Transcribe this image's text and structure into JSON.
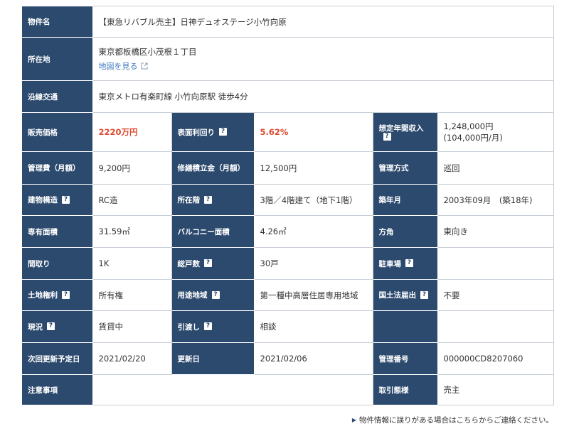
{
  "rows": {
    "name": {
      "label": "物件名",
      "value": "【東急リバブル売主】日神デュオステージ小竹向原"
    },
    "address": {
      "label": "所在地",
      "value": "東京都板橋区小茂根１丁目",
      "map_link": "地図を見る"
    },
    "line": {
      "label": "沿線交通",
      "value": "東京メトロ有楽町線 小竹向原駅 徒歩4分"
    },
    "price": {
      "label": "販売価格",
      "value": "2220万円"
    },
    "yield": {
      "label": "表面利回り",
      "value": "5.62%"
    },
    "income": {
      "label": "想定年間収入",
      "value1": "1,248,000円",
      "value2": "(104,000円/月)"
    },
    "mgmt_fee": {
      "label": "管理費（月額）",
      "value": "9,200円"
    },
    "repair_fund": {
      "label": "修繕積立金（月額）",
      "value": "12,500円"
    },
    "mgmt_method": {
      "label": "管理方式",
      "value": "巡回"
    },
    "structure": {
      "label": "建物構造",
      "value": "RC造"
    },
    "floor": {
      "label": "所在階",
      "value": "3階／4階建て（地下1階）"
    },
    "built": {
      "label": "築年月",
      "value": "2003年09月　(築18年)"
    },
    "area": {
      "label": "専有面積",
      "value": "31.59㎡"
    },
    "balcony": {
      "label": "バルコニー面積",
      "value": "4.26㎡"
    },
    "direction": {
      "label": "方角",
      "value": "東向き"
    },
    "layout": {
      "label": "間取り",
      "value": "1K"
    },
    "units": {
      "label": "総戸数",
      "value": "30戸"
    },
    "parking": {
      "label": "駐車場",
      "value": ""
    },
    "land_right": {
      "label": "土地権利",
      "value": "所有権"
    },
    "zoning": {
      "label": "用途地域",
      "value": "第一種中高層住居専用地域"
    },
    "notification": {
      "label": "国土法届出",
      "value": "不要"
    },
    "status": {
      "label": "現況",
      "value": "賃貸中"
    },
    "handover": {
      "label": "引渡し",
      "value": "相談"
    },
    "next_update": {
      "label": "次回更新予定日",
      "value": "2021/02/20"
    },
    "updated": {
      "label": "更新日",
      "value": "2021/02/06"
    },
    "mgmt_no": {
      "label": "管理番号",
      "value": "000000CD8207060"
    },
    "notes": {
      "label": "注意事項",
      "value": ""
    },
    "transaction": {
      "label": "取引態様",
      "value": "売主"
    }
  },
  "help_mark": "?",
  "footer_link": "物件情報に誤りがある場合はこちらからご連絡ください。"
}
